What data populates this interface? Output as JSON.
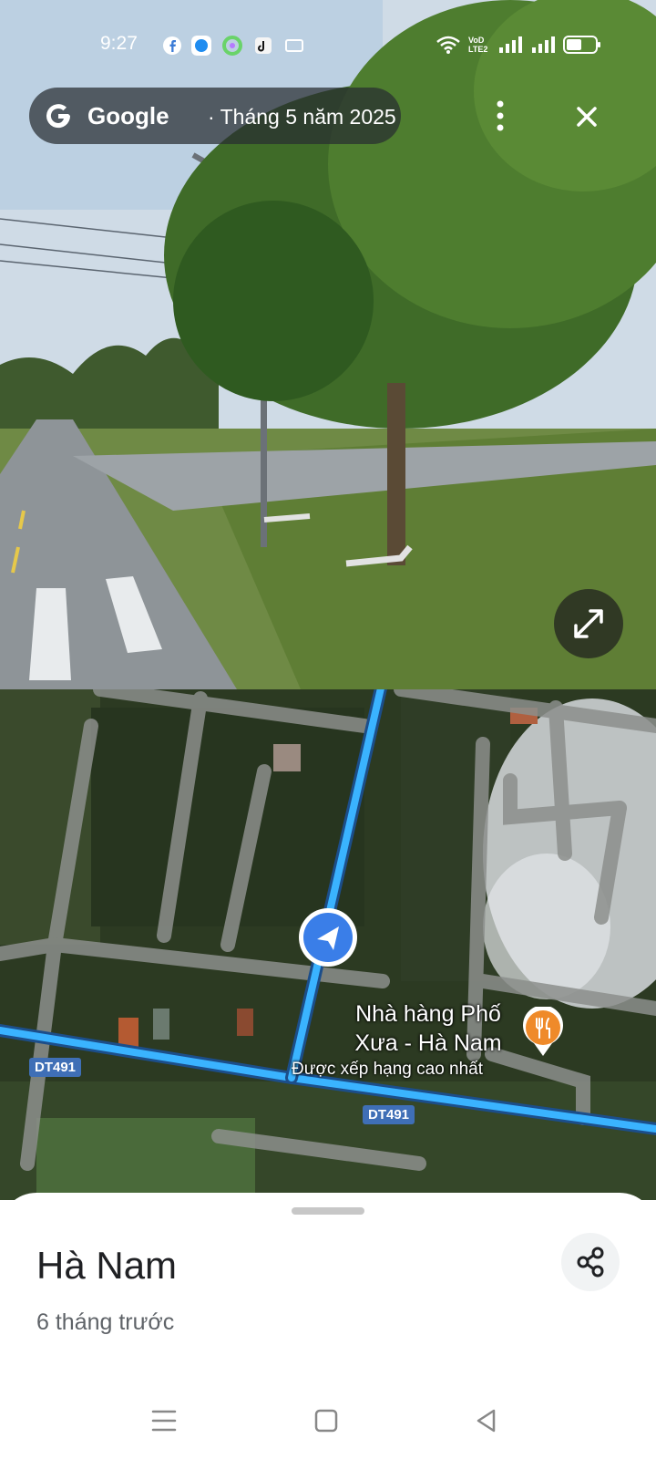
{
  "status_bar": {
    "time": "9:27",
    "icons": [
      "facebook-icon",
      "messenger-icon",
      "app-icon",
      "tiktok-icon",
      "notification-icon"
    ],
    "right_icons": [
      "wifi-icon",
      "volte-icon",
      "signal-icon",
      "signal-icon",
      "battery-icon"
    ],
    "volte_label": "VoD LTE2"
  },
  "street_view": {
    "brand": "Google",
    "date_text": "· Tháng 5 năm 2025"
  },
  "map": {
    "road_labels": [
      "DT491",
      "DT491"
    ],
    "poi": {
      "name": "Nhà hàng Phố Xưa - Hà Nam",
      "subtitle": "Được xếp hạng cao nhất",
      "icon": "restaurant-icon"
    }
  },
  "sheet": {
    "title": "Hà Nam",
    "time_ago": "6 tháng trước"
  },
  "colors": {
    "route_blue": "#3ab3ff",
    "poi_orange": "#ef8a2a",
    "marker_blue": "#3a7ee8"
  }
}
